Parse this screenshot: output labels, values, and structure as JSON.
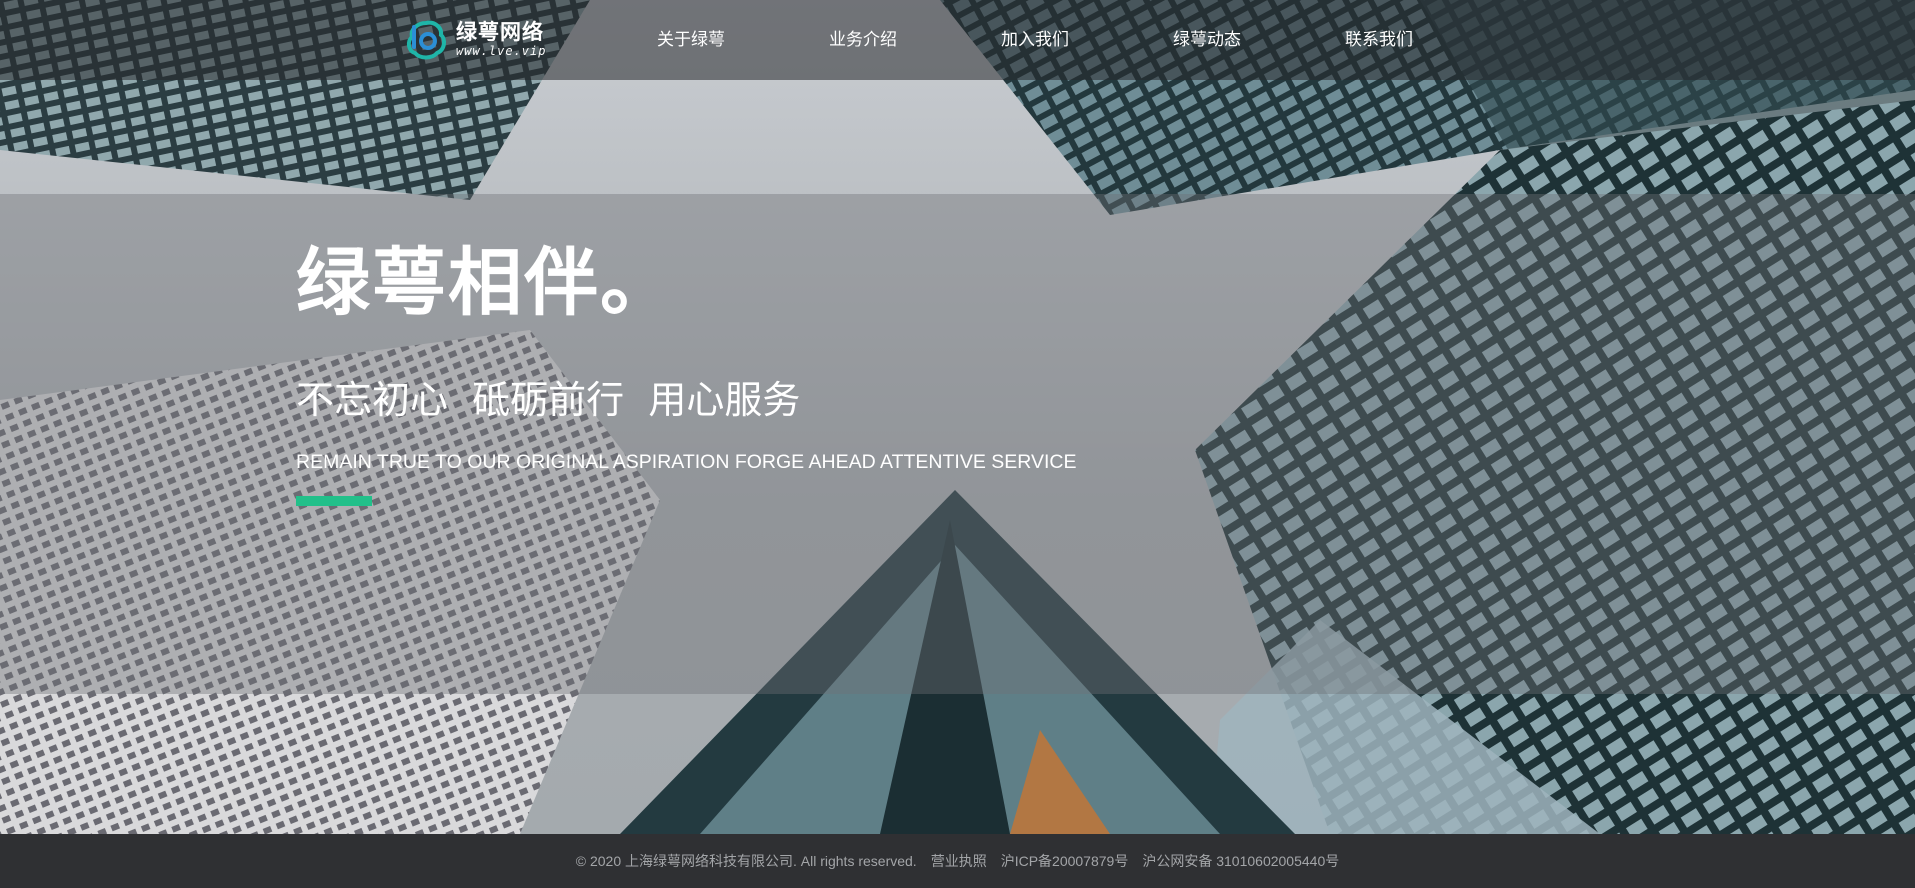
{
  "brand": {
    "name": "绿萼网络",
    "url_text": "www.lve.vip",
    "logo_icon": "lve-logo-icon",
    "colors": {
      "accent": "#22c08a",
      "logo_teal": "#1fb5a8",
      "logo_blue": "#2b8fd6"
    }
  },
  "nav": {
    "items": [
      {
        "label": "关于绿萼"
      },
      {
        "label": "业务介绍"
      },
      {
        "label": "加入我们"
      },
      {
        "label": "绿萼动态"
      },
      {
        "label": "联系我们"
      }
    ]
  },
  "hero": {
    "title": "绿萼相伴。",
    "subtitle": "不忘初心  砥砺前行  用心服务",
    "subtitle_en": "REMAIN TRUE TO OUR ORIGINAL ASPIRATION FORGE AHEAD ATTENTIVE SERVICE"
  },
  "footer": {
    "copyright": "© 2020 上海绿萼网络科技有限公司. All rights reserved.",
    "license": "营业执照",
    "icp": "沪ICP备20007879号",
    "police": "沪公网安备 31010602005440号"
  }
}
